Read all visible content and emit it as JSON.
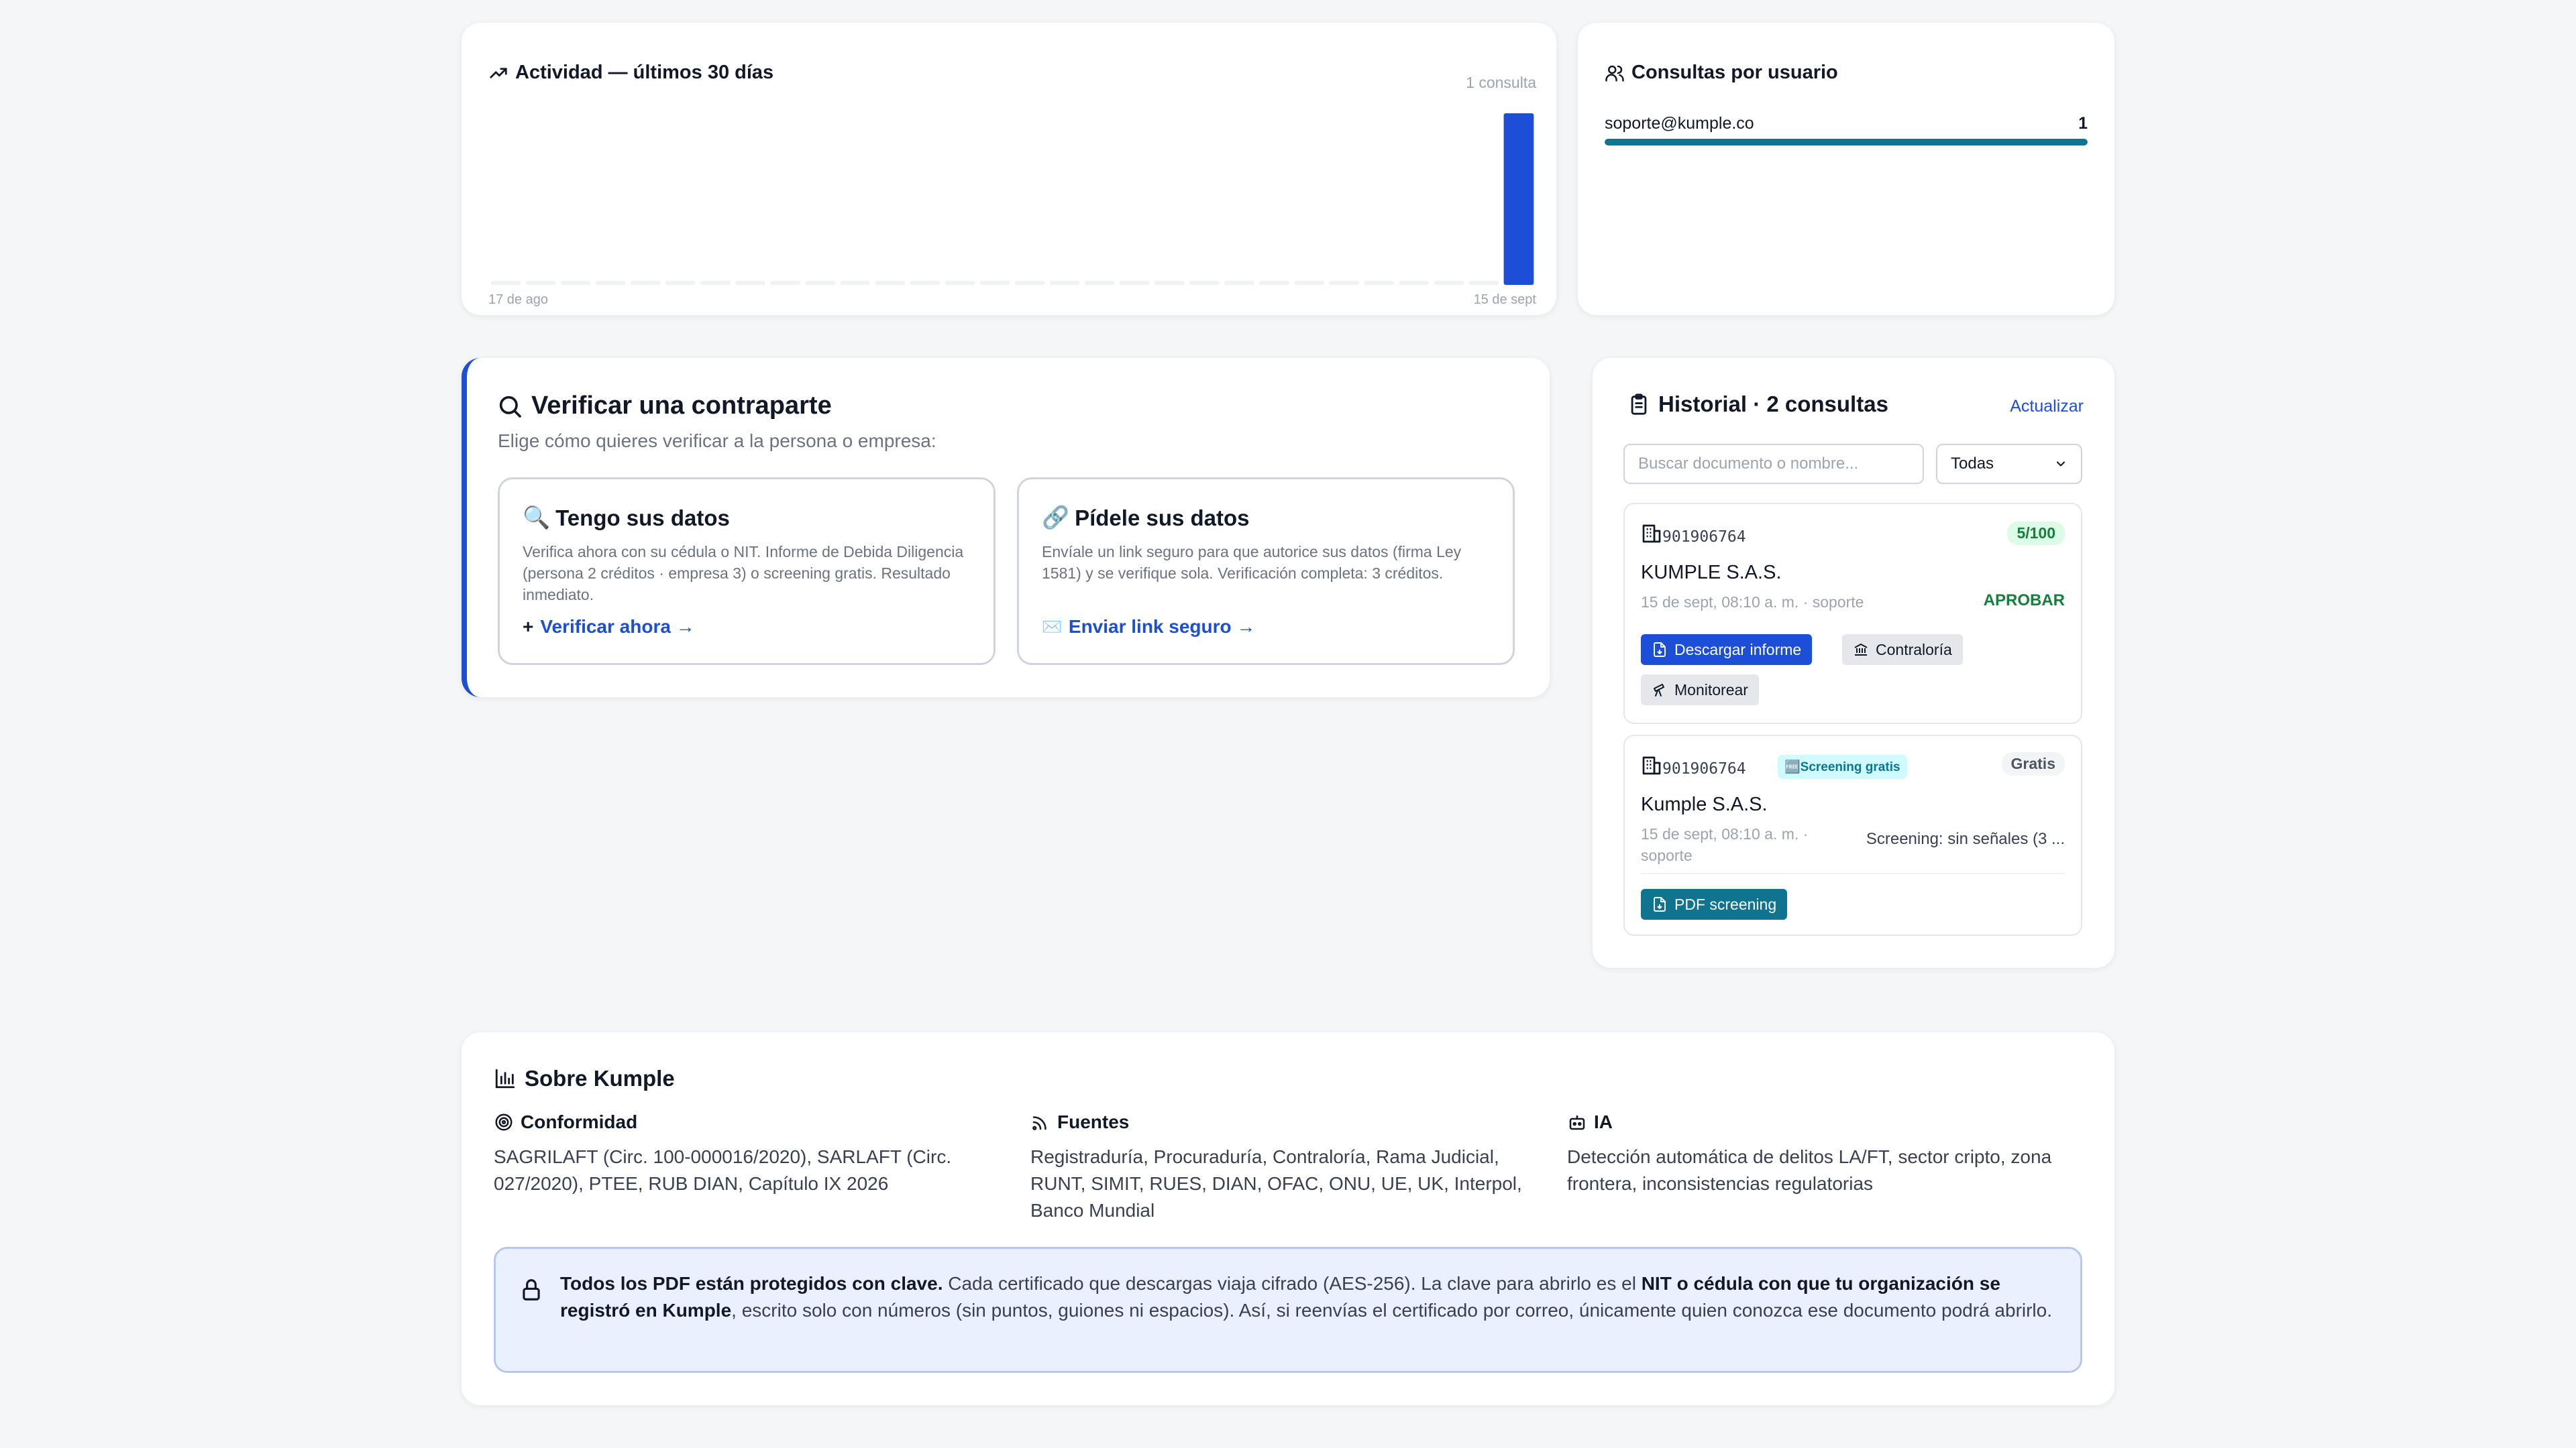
{
  "activity": {
    "title": "Actividad — últimos 30 días",
    "count_label": "1 consulta",
    "x_start_label": "17 de ago",
    "x_end_label": "15 de sept",
    "accent_color": "#1d4ed8",
    "chart_data": {
      "type": "bar",
      "title": "Actividad — últimos 30 días",
      "x_range": [
        "17 de ago",
        "15 de sept"
      ],
      "values": [
        0,
        0,
        0,
        0,
        0,
        0,
        0,
        0,
        0,
        0,
        0,
        0,
        0,
        0,
        0,
        0,
        0,
        0,
        0,
        0,
        0,
        0,
        0,
        0,
        0,
        0,
        0,
        0,
        0,
        1
      ],
      "ylim": [
        0,
        1
      ]
    }
  },
  "users": {
    "title": "Consultas por usuario",
    "rows": [
      {
        "name": "soporte@kumple.co",
        "value": "1",
        "fraction": 1.0
      }
    ]
  },
  "verify": {
    "title": "Verificar una contraparte",
    "subtitle": "Elige cómo quieres verificar a la persona o empresa:",
    "option1": {
      "icon": "🔍",
      "title": "Tengo sus datos",
      "desc": "Verifica ahora con su cédula o NIT. Informe de Debida Diligencia (persona 2 créditos · empresa 3) o screening gratis. Resultado inmediato.",
      "action_glyph": "+",
      "action": "Verificar ahora →"
    },
    "option2": {
      "icon": "🔗",
      "title": "Pídele sus datos",
      "desc": "Envíale un link seguro para que autorice sus datos (firma Ley 1581) y se verifique sola. Verificación completa: 3 créditos.",
      "action_glyph": "✉️",
      "action": "Enviar link seguro →"
    }
  },
  "history": {
    "title": "Historial · 2 consultas",
    "refresh": "Actualizar",
    "search_placeholder": "Buscar documento o nombre...",
    "filter_value": "Todas",
    "items": [
      {
        "nit": "901906764",
        "score": "5/100",
        "name": "KUMPLE S.A.S.",
        "meta": "15 de sept, 08:10 a. m. · soporte",
        "decision": "APROBAR",
        "actions": [
          "Descargar informe",
          "Contraloría",
          "Monitorear"
        ]
      },
      {
        "nit": "901906764",
        "tag": "🆓Screening gratis",
        "badge": "Gratis",
        "name": "Kumple S.A.S.",
        "meta_line1": "15 de sept, 08:10 a. m. ·",
        "meta_line2": "soporte",
        "result": "Screening: sin señales (3 ...",
        "action": "PDF screening"
      }
    ]
  },
  "about": {
    "title": "Sobre Kumple",
    "columns": [
      {
        "title": "Conformidad",
        "text": "SAGRILAFT (Circ. 100-000016/2020), SARLAFT (Circ. 027/2020), PTEE, RUB DIAN, Capítulo IX 2026"
      },
      {
        "title": "Fuentes",
        "text": "Registraduría, Procuraduría, Contraloría, Rama Judicial, RUNT, SIMIT, RUES, DIAN, OFAC, ONU, UE, UK, Interpol, Banco Mundial"
      },
      {
        "title": "IA",
        "text": "Detección automática de delitos LA/FT, sector cripto, zona frontera, inconsistencias regulatorias"
      }
    ],
    "notice": {
      "bold1": "Todos los PDF están protegidos con clave.",
      "text1": " Cada certificado que descargas viaja cifrado (AES-256). La clave para abrirlo es el ",
      "bold2": "NIT o cédula con que tu organización se registró en Kumple",
      "text2": ", escrito solo con números (sin puntos, guiones ni espacios). Así, si reenvías el certificado por correo, únicamente quien conozca ese documento podrá abrirlo."
    }
  }
}
